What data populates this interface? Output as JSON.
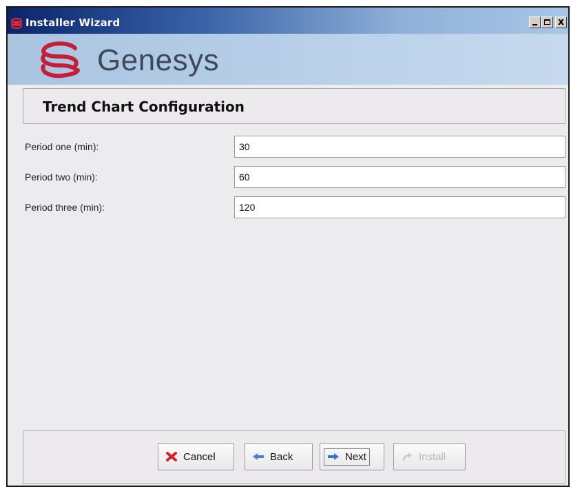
{
  "window": {
    "title": "Installer Wizard",
    "controls": [
      "minimize",
      "maximize",
      "close"
    ],
    "close_glyph": "x"
  },
  "banner": {
    "brand_name": "Genesys",
    "brand_color": "#c41e3a"
  },
  "section": {
    "title": "Trend Chart Configuration"
  },
  "form": {
    "fields": [
      {
        "label": "Period one (min):",
        "value": "30"
      },
      {
        "label": "Period two (min):",
        "value": "60"
      },
      {
        "label": "Period three (min):",
        "value": "120"
      }
    ]
  },
  "footer": {
    "buttons": [
      {
        "label": "Cancel",
        "icon": "red-x-icon",
        "enabled": true
      },
      {
        "label": "Back",
        "icon": "left-arrow-icon",
        "enabled": true
      },
      {
        "label": "Next",
        "icon": "right-arrow-icon",
        "enabled": true,
        "focused": true
      },
      {
        "label": "Install",
        "icon": "curved-arrow-icon",
        "enabled": false
      }
    ]
  }
}
